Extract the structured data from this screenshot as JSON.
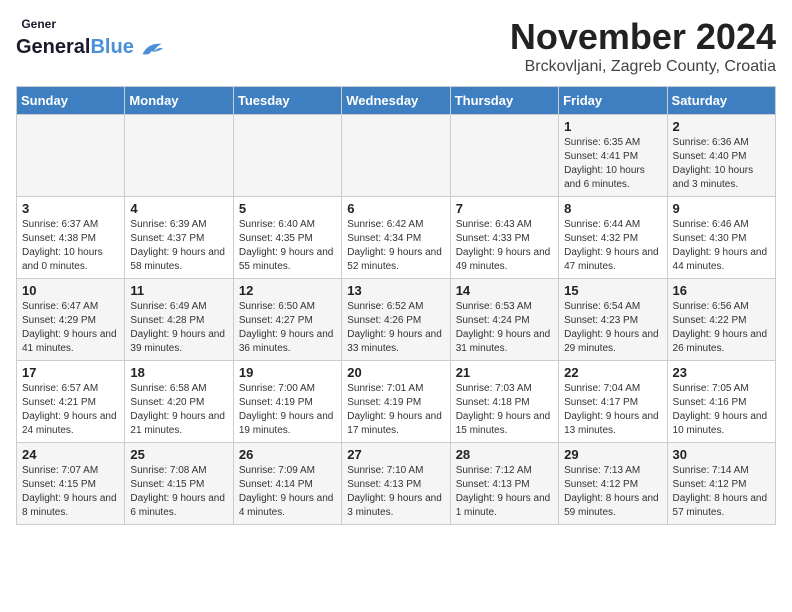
{
  "logo": {
    "general": "General",
    "blue": "Blue"
  },
  "title": "November 2024",
  "location": "Brckovljani, Zagreb County, Croatia",
  "days_of_week": [
    "Sunday",
    "Monday",
    "Tuesday",
    "Wednesday",
    "Thursday",
    "Friday",
    "Saturday"
  ],
  "weeks": [
    [
      {
        "day": "",
        "info": ""
      },
      {
        "day": "",
        "info": ""
      },
      {
        "day": "",
        "info": ""
      },
      {
        "day": "",
        "info": ""
      },
      {
        "day": "",
        "info": ""
      },
      {
        "day": "1",
        "info": "Sunrise: 6:35 AM\nSunset: 4:41 PM\nDaylight: 10 hours and 6 minutes."
      },
      {
        "day": "2",
        "info": "Sunrise: 6:36 AM\nSunset: 4:40 PM\nDaylight: 10 hours and 3 minutes."
      }
    ],
    [
      {
        "day": "3",
        "info": "Sunrise: 6:37 AM\nSunset: 4:38 PM\nDaylight: 10 hours and 0 minutes."
      },
      {
        "day": "4",
        "info": "Sunrise: 6:39 AM\nSunset: 4:37 PM\nDaylight: 9 hours and 58 minutes."
      },
      {
        "day": "5",
        "info": "Sunrise: 6:40 AM\nSunset: 4:35 PM\nDaylight: 9 hours and 55 minutes."
      },
      {
        "day": "6",
        "info": "Sunrise: 6:42 AM\nSunset: 4:34 PM\nDaylight: 9 hours and 52 minutes."
      },
      {
        "day": "7",
        "info": "Sunrise: 6:43 AM\nSunset: 4:33 PM\nDaylight: 9 hours and 49 minutes."
      },
      {
        "day": "8",
        "info": "Sunrise: 6:44 AM\nSunset: 4:32 PM\nDaylight: 9 hours and 47 minutes."
      },
      {
        "day": "9",
        "info": "Sunrise: 6:46 AM\nSunset: 4:30 PM\nDaylight: 9 hours and 44 minutes."
      }
    ],
    [
      {
        "day": "10",
        "info": "Sunrise: 6:47 AM\nSunset: 4:29 PM\nDaylight: 9 hours and 41 minutes."
      },
      {
        "day": "11",
        "info": "Sunrise: 6:49 AM\nSunset: 4:28 PM\nDaylight: 9 hours and 39 minutes."
      },
      {
        "day": "12",
        "info": "Sunrise: 6:50 AM\nSunset: 4:27 PM\nDaylight: 9 hours and 36 minutes."
      },
      {
        "day": "13",
        "info": "Sunrise: 6:52 AM\nSunset: 4:26 PM\nDaylight: 9 hours and 33 minutes."
      },
      {
        "day": "14",
        "info": "Sunrise: 6:53 AM\nSunset: 4:24 PM\nDaylight: 9 hours and 31 minutes."
      },
      {
        "day": "15",
        "info": "Sunrise: 6:54 AM\nSunset: 4:23 PM\nDaylight: 9 hours and 29 minutes."
      },
      {
        "day": "16",
        "info": "Sunrise: 6:56 AM\nSunset: 4:22 PM\nDaylight: 9 hours and 26 minutes."
      }
    ],
    [
      {
        "day": "17",
        "info": "Sunrise: 6:57 AM\nSunset: 4:21 PM\nDaylight: 9 hours and 24 minutes."
      },
      {
        "day": "18",
        "info": "Sunrise: 6:58 AM\nSunset: 4:20 PM\nDaylight: 9 hours and 21 minutes."
      },
      {
        "day": "19",
        "info": "Sunrise: 7:00 AM\nSunset: 4:19 PM\nDaylight: 9 hours and 19 minutes."
      },
      {
        "day": "20",
        "info": "Sunrise: 7:01 AM\nSunset: 4:19 PM\nDaylight: 9 hours and 17 minutes."
      },
      {
        "day": "21",
        "info": "Sunrise: 7:03 AM\nSunset: 4:18 PM\nDaylight: 9 hours and 15 minutes."
      },
      {
        "day": "22",
        "info": "Sunrise: 7:04 AM\nSunset: 4:17 PM\nDaylight: 9 hours and 13 minutes."
      },
      {
        "day": "23",
        "info": "Sunrise: 7:05 AM\nSunset: 4:16 PM\nDaylight: 9 hours and 10 minutes."
      }
    ],
    [
      {
        "day": "24",
        "info": "Sunrise: 7:07 AM\nSunset: 4:15 PM\nDaylight: 9 hours and 8 minutes."
      },
      {
        "day": "25",
        "info": "Sunrise: 7:08 AM\nSunset: 4:15 PM\nDaylight: 9 hours and 6 minutes."
      },
      {
        "day": "26",
        "info": "Sunrise: 7:09 AM\nSunset: 4:14 PM\nDaylight: 9 hours and 4 minutes."
      },
      {
        "day": "27",
        "info": "Sunrise: 7:10 AM\nSunset: 4:13 PM\nDaylight: 9 hours and 3 minutes."
      },
      {
        "day": "28",
        "info": "Sunrise: 7:12 AM\nSunset: 4:13 PM\nDaylight: 9 hours and 1 minute."
      },
      {
        "day": "29",
        "info": "Sunrise: 7:13 AM\nSunset: 4:12 PM\nDaylight: 8 hours and 59 minutes."
      },
      {
        "day": "30",
        "info": "Sunrise: 7:14 AM\nSunset: 4:12 PM\nDaylight: 8 hours and 57 minutes."
      }
    ]
  ]
}
